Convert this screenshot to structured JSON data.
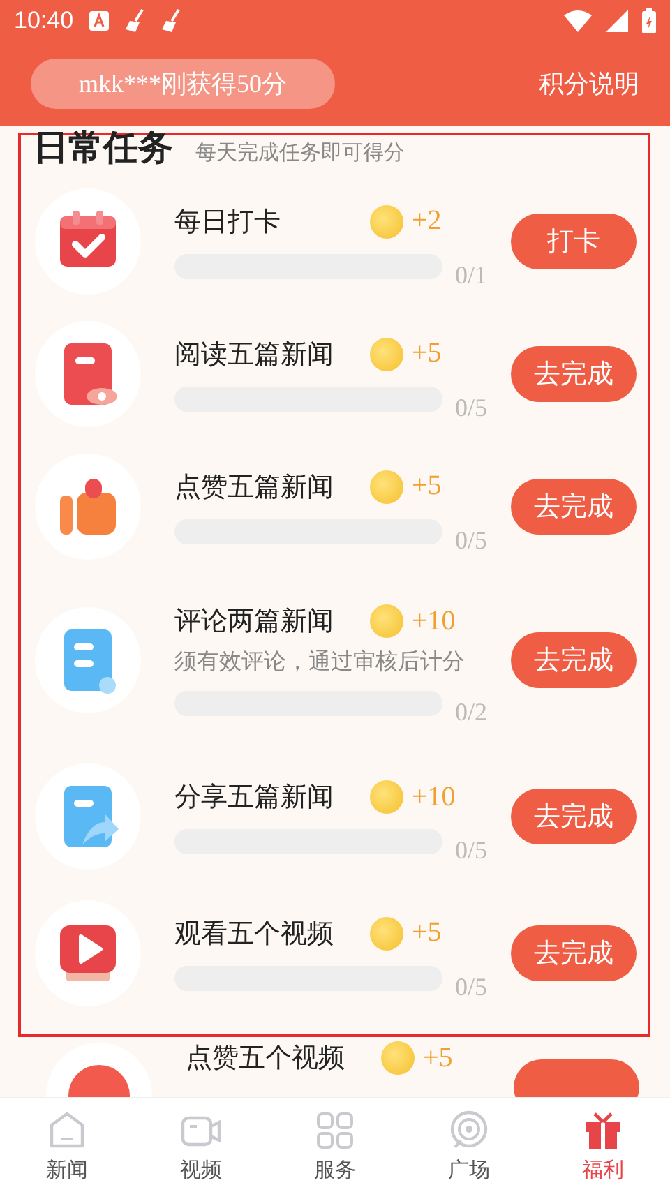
{
  "status_bar": {
    "time": "10:40"
  },
  "header": {
    "ticker": "mkk***刚获得50分",
    "link": "积分说明"
  },
  "section": {
    "title": "日常任务",
    "subtitle": "每天完成任务即可得分"
  },
  "tasks": [
    {
      "title": "每日打卡",
      "reward": "+2",
      "progress": {
        "level": 0,
        "count": "0/1"
      },
      "button": "打卡"
    },
    {
      "title": "阅读五篇新闻",
      "reward": "+5",
      "progress": {
        "level": 0,
        "count": "0/5"
      },
      "button": "去完成"
    },
    {
      "title": "点赞五篇新闻",
      "reward": "+5",
      "progress": {
        "level": 0,
        "count": "0/5"
      },
      "button": "去完成"
    },
    {
      "title": "评论两篇新闻",
      "reward": "+10",
      "note": "须有效评论，通过审核后计分",
      "progress": {
        "level": 0,
        "count": "0/2"
      },
      "button": "去完成"
    },
    {
      "title": "分享五篇新闻",
      "reward": "+10",
      "progress": {
        "level": 0,
        "count": "0/5"
      },
      "button": "去完成"
    },
    {
      "title": "观看五个视频",
      "reward": "+5",
      "progress": {
        "level": 0,
        "count": "0/5"
      },
      "button": "去完成"
    }
  ],
  "partial_task": {
    "title": "点赞五个视频",
    "reward": "+5"
  },
  "nav": [
    {
      "label": "新闻",
      "selected": false
    },
    {
      "label": "视频",
      "selected": false
    },
    {
      "label": "服务",
      "selected": false
    },
    {
      "label": "广场",
      "selected": false
    },
    {
      "label": "福利",
      "selected": true
    }
  ]
}
